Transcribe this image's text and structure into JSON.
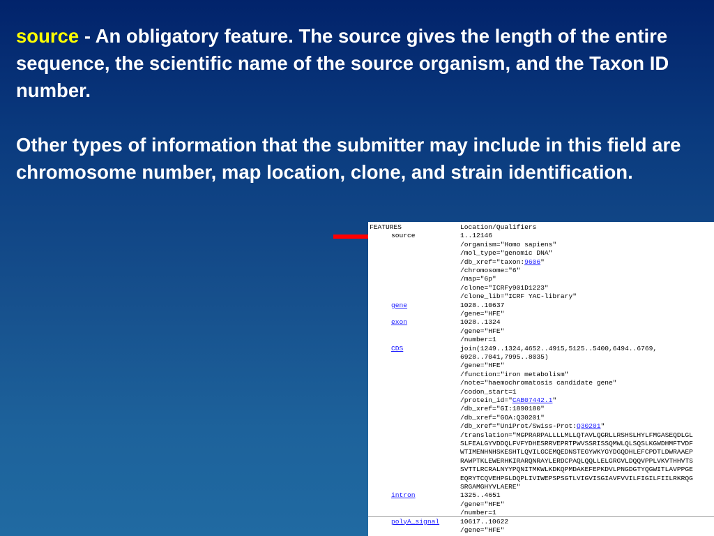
{
  "slide": {
    "keyword": "source",
    "para1_rest": " - An obligatory feature. The source gives the length of the entire sequence, the scientific name of the source organism, and the Taxon ID number.",
    "para2": "Other types of information that the submitter may include in this field are chromosome number, map location, clone, and strain identification."
  },
  "colors": {
    "keyword": "#ffff00",
    "arrow": "#ff0000",
    "link": "#1a1aff"
  },
  "arrow_icon": "red-right-arrow-icon",
  "genbank": {
    "lines": [
      {
        "key": "FEATURES",
        "key_indent": false,
        "key_link": false,
        "parts": [
          {
            "t": "Location/Qualifiers"
          }
        ]
      },
      {
        "key": "source",
        "key_indent": true,
        "key_link": false,
        "parts": [
          {
            "t": "1..12146"
          }
        ]
      },
      {
        "key": "",
        "parts": [
          {
            "t": "/organism=\"Homo sapiens\""
          }
        ]
      },
      {
        "key": "",
        "parts": [
          {
            "t": "/mol_type=\"genomic DNA\""
          }
        ]
      },
      {
        "key": "",
        "parts": [
          {
            "t": "/db_xref=\"taxon:"
          },
          {
            "t": "9606",
            "link": true
          },
          {
            "t": "\""
          }
        ]
      },
      {
        "key": "",
        "parts": [
          {
            "t": "/chromosome=\"6\""
          }
        ]
      },
      {
        "key": "",
        "parts": [
          {
            "t": "/map=\"6p\""
          }
        ]
      },
      {
        "key": "",
        "parts": [
          {
            "t": "/clone=\"ICRFy901D1223\""
          }
        ]
      },
      {
        "key": "",
        "parts": [
          {
            "t": "/clone_lib=\"ICRF YAC-library\""
          }
        ]
      },
      {
        "key": "gene",
        "key_indent": true,
        "key_link": true,
        "parts": [
          {
            "t": "1028..10637"
          }
        ]
      },
      {
        "key": "",
        "parts": [
          {
            "t": "/gene=\"HFE\""
          }
        ]
      },
      {
        "key": "exon",
        "key_indent": true,
        "key_link": true,
        "parts": [
          {
            "t": "1028..1324"
          }
        ]
      },
      {
        "key": "",
        "parts": [
          {
            "t": "/gene=\"HFE\""
          }
        ]
      },
      {
        "key": "",
        "parts": [
          {
            "t": "/number=1"
          }
        ]
      },
      {
        "key": "CDS",
        "key_indent": true,
        "key_link": true,
        "parts": [
          {
            "t": "join(1249..1324,4652..4915,5125..5400,6494..6769,"
          }
        ]
      },
      {
        "key": "",
        "parts": [
          {
            "t": "6928..7041,7995..8035)"
          }
        ]
      },
      {
        "key": "",
        "parts": [
          {
            "t": "/gene=\"HFE\""
          }
        ]
      },
      {
        "key": "",
        "parts": [
          {
            "t": "/function=\"iron metabolism\""
          }
        ]
      },
      {
        "key": "",
        "parts": [
          {
            "t": "/note=\"haemochromatosis candidate gene\""
          }
        ]
      },
      {
        "key": "",
        "parts": [
          {
            "t": "/codon_start=1"
          }
        ]
      },
      {
        "key": "",
        "parts": [
          {
            "t": "/protein_id=\""
          },
          {
            "t": "CAB07442.1",
            "link": true
          },
          {
            "t": "\""
          }
        ]
      },
      {
        "key": "",
        "parts": [
          {
            "t": "/db_xref=\"GI:1890180\""
          }
        ]
      },
      {
        "key": "",
        "parts": [
          {
            "t": "/db_xref=\"GOA:Q30201\""
          }
        ]
      },
      {
        "key": "",
        "parts": [
          {
            "t": "/db_xref=\"UniProt/Swiss-Prot:"
          },
          {
            "t": "Q30201",
            "link": true
          },
          {
            "t": "\""
          }
        ]
      },
      {
        "key": "",
        "parts": [
          {
            "t": "/translation=\"MGPRARPALLLLMLLQTAVLQGRLLRSHSLHYLFMGASEQDLGL"
          }
        ]
      },
      {
        "key": "",
        "parts": [
          {
            "t": "SLFEALGYVDDQLFVFYDHESRRVEPRTPWVSSRISSQMWLQLSQSLKGWDHMFTVDF"
          }
        ]
      },
      {
        "key": "",
        "parts": [
          {
            "t": "WTIMENHNHSKESHTLQVILGCEMQEDNSTEGYWKYGYDGQDHLEFCPDTLDWRAAEP"
          }
        ]
      },
      {
        "key": "",
        "parts": [
          {
            "t": "RAWPTKLEWERHKIRARQNRAYLERDCPAQLQQLLELGRGVLDQQVPPLVKVTHHVTS"
          }
        ]
      },
      {
        "key": "",
        "parts": [
          {
            "t": "SVTTLRCRALNYYPQNITMKWLKDKQPMDAKEFEPKDVLPNGDGTYQGWITLAVPPGE"
          }
        ]
      },
      {
        "key": "",
        "parts": [
          {
            "t": "EQRYTCQVEHPGLDQPLIVIWEPSPSGTLVIGVISGIAVFVVILFIGILFIILRKRQG"
          }
        ]
      },
      {
        "key": "",
        "parts": [
          {
            "t": "SRGAMGHYVLAERE\""
          }
        ]
      },
      {
        "key": "intron",
        "key_indent": true,
        "key_link": true,
        "parts": [
          {
            "t": "1325..4651"
          }
        ]
      },
      {
        "key": "",
        "parts": [
          {
            "t": "/gene=\"HFE\""
          }
        ]
      },
      {
        "key": "",
        "parts": [
          {
            "t": "/number=1"
          }
        ]
      },
      {
        "key": "polyA_signal",
        "key_indent": true,
        "key_link": true,
        "parts": [
          {
            "t": "10617..10622"
          }
        ]
      },
      {
        "key": "",
        "parts": [
          {
            "t": "/gene=\"HFE\""
          }
        ]
      }
    ]
  }
}
